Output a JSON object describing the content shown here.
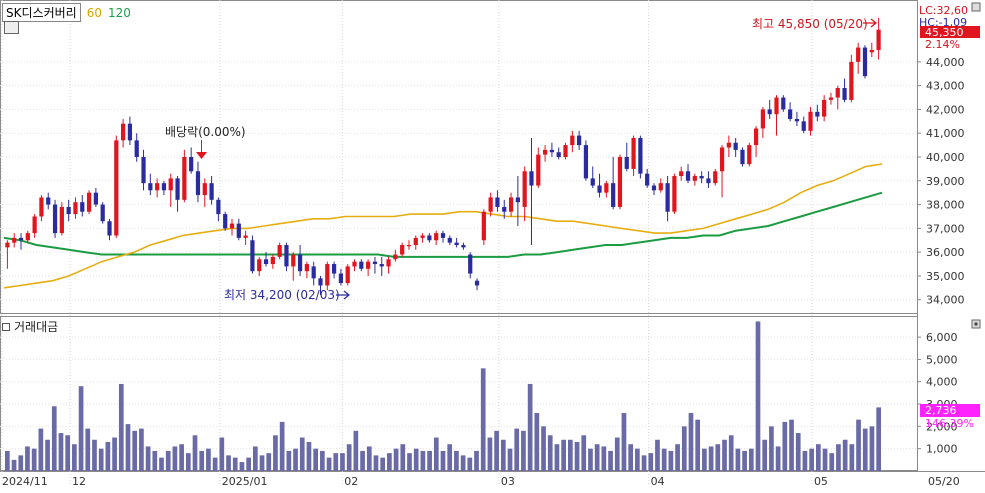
{
  "header": {
    "stock_name": "SK디스커버리",
    "ma60_label": "60",
    "ma120_label": "120"
  },
  "right_labels": {
    "lc": "LC:32,60",
    "hc": "HC:-1,09",
    "current_price": "45,350",
    "change_pct": "2.14%"
  },
  "annotations": {
    "high": "최고 45,850 (05/20)",
    "low": "최저 34,200 (02/03)",
    "dividend": "배당락(0.00%)"
  },
  "volume_panel": {
    "title": "거래대금",
    "current_value": "2,736",
    "pct": "146.39%"
  },
  "colors": {
    "up": "#e0161f",
    "down": "#2b2ba0",
    "ma60": "#e6ad10",
    "ma120": "#1b9c42",
    "vol": "#6a6aa6",
    "badge_red": "#e0161f",
    "badge_magenta": "#ff22ff"
  },
  "chart_data": [
    {
      "type": "candlestick",
      "ylim": [
        33400,
        46600
      ],
      "yticks": [
        "34,000",
        "35,000",
        "36,000",
        "37,000",
        "38,000",
        "39,000",
        "40,000",
        "41,000",
        "42,000",
        "43,000",
        "44,000"
      ],
      "x_labels": [
        "2024/11",
        "12",
        "2025/01",
        "02",
        "03",
        "04",
        "05",
        "05/20"
      ],
      "candles": [
        [
          36200,
          36500,
          35300,
          36400
        ],
        [
          36400,
          36800,
          36200,
          36600
        ],
        [
          36600,
          36800,
          36100,
          36500
        ],
        [
          36500,
          36900,
          36400,
          36800
        ],
        [
          36800,
          37600,
          36600,
          37500
        ],
        [
          37500,
          38400,
          37300,
          38300
        ],
        [
          38300,
          38500,
          37800,
          38000
        ],
        [
          38000,
          38200,
          36600,
          36800
        ],
        [
          36800,
          38100,
          36700,
          37900
        ],
        [
          37900,
          38200,
          37300,
          37600
        ],
        [
          37600,
          38300,
          37400,
          38100
        ],
        [
          38100,
          38400,
          37500,
          37700
        ],
        [
          37700,
          38600,
          37600,
          38500
        ],
        [
          38500,
          38700,
          37900,
          38000
        ],
        [
          38000,
          38100,
          37200,
          37300
        ],
        [
          37300,
          37400,
          36500,
          36700
        ],
        [
          36700,
          40900,
          36600,
          40700
        ],
        [
          40700,
          41600,
          40400,
          41400
        ],
        [
          41400,
          41700,
          40500,
          40700
        ],
        [
          40700,
          41000,
          39800,
          40000
        ],
        [
          40000,
          40300,
          38600,
          38900
        ],
        [
          38900,
          39300,
          38400,
          38600
        ],
        [
          38600,
          39100,
          38300,
          38900
        ],
        [
          38900,
          39000,
          38400,
          38600
        ],
        [
          38600,
          39300,
          37900,
          39100
        ],
        [
          39100,
          39200,
          37700,
          38200
        ],
        [
          38200,
          40300,
          38100,
          40000
        ],
        [
          40000,
          40400,
          39300,
          39400
        ],
        [
          39400,
          39800,
          38100,
          38400
        ],
        [
          38400,
          39100,
          37900,
          38900
        ],
        [
          38900,
          39200,
          38000,
          38200
        ],
        [
          38200,
          38300,
          37300,
          37600
        ],
        [
          37600,
          37700,
          36900,
          37000
        ],
        [
          37000,
          37400,
          36700,
          37200
        ],
        [
          37200,
          37400,
          36500,
          36600
        ],
        [
          36600,
          36900,
          36300,
          36700
        ],
        [
          36500,
          36700,
          35100,
          35200
        ],
        [
          35200,
          35800,
          35000,
          35700
        ],
        [
          35700,
          36000,
          35400,
          35500
        ],
        [
          35500,
          35900,
          35300,
          35800
        ],
        [
          35800,
          36400,
          35700,
          36300
        ],
        [
          36300,
          36400,
          35200,
          35400
        ],
        [
          35400,
          36000,
          34800,
          35900
        ],
        [
          35900,
          36300,
          35000,
          35200
        ],
        [
          35200,
          35600,
          34900,
          35500
        ],
        [
          35400,
          35600,
          34600,
          34900
        ],
        [
          34900,
          35000,
          34200,
          34600
        ],
        [
          34600,
          35600,
          34400,
          35500
        ],
        [
          35500,
          35600,
          34900,
          35100
        ],
        [
          35100,
          35300,
          34600,
          34700
        ],
        [
          34700,
          35500,
          34600,
          35400
        ],
        [
          35400,
          35700,
          35200,
          35600
        ],
        [
          35600,
          35700,
          35200,
          35300
        ],
        [
          35300,
          35700,
          35000,
          35600
        ],
        [
          35600,
          35800,
          35100,
          35500
        ],
        [
          35500,
          35800,
          35000,
          35400
        ],
        [
          35400,
          35800,
          35100,
          35700
        ],
        [
          35700,
          36100,
          35600,
          35900
        ],
        [
          35900,
          36400,
          35800,
          36300
        ],
        [
          36300,
          36500,
          36100,
          36300
        ],
        [
          36300,
          36700,
          36100,
          36600
        ],
        [
          36600,
          36800,
          36400,
          36700
        ],
        [
          36700,
          36800,
          36400,
          36500
        ],
        [
          36500,
          36900,
          36300,
          36800
        ],
        [
          36800,
          36900,
          36400,
          36600
        ],
        [
          36600,
          36700,
          36300,
          36400
        ],
        [
          36400,
          36600,
          36200,
          36300
        ],
        [
          36300,
          36400,
          36100,
          36200
        ],
        [
          35900,
          36000,
          34900,
          35100
        ],
        [
          34800,
          34900,
          34400,
          34600
        ],
        [
          36500,
          37800,
          36300,
          37700
        ],
        [
          37700,
          38500,
          37500,
          38300
        ],
        [
          38300,
          38600,
          37700,
          37900
        ],
        [
          37900,
          38200,
          37400,
          37700
        ],
        [
          37700,
          38500,
          37500,
          38300
        ],
        [
          38300,
          39200,
          37100,
          38100
        ],
        [
          37900,
          39600,
          37300,
          39400
        ],
        [
          39400,
          40800,
          36300,
          38800
        ],
        [
          38800,
          40400,
          38700,
          40100
        ],
        [
          40100,
          40500,
          39800,
          40300
        ],
        [
          40300,
          40600,
          40000,
          40200
        ],
        [
          40200,
          40400,
          39900,
          40000
        ],
        [
          40000,
          40600,
          39900,
          40500
        ],
        [
          40500,
          41100,
          40200,
          40900
        ],
        [
          40900,
          41100,
          40300,
          40500
        ],
        [
          40500,
          40700,
          39000,
          39100
        ],
        [
          39100,
          39600,
          38700,
          38800
        ],
        [
          38800,
          39300,
          38300,
          38500
        ],
        [
          38500,
          39000,
          38300,
          38900
        ],
        [
          38900,
          40000,
          37800,
          37900
        ],
        [
          37900,
          40100,
          37800,
          40000
        ],
        [
          40000,
          40600,
          39400,
          39500
        ],
        [
          39500,
          40900,
          39200,
          40800
        ],
        [
          40800,
          40900,
          39100,
          39300
        ],
        [
          39300,
          39500,
          38700,
          38800
        ],
        [
          38800,
          38900,
          38400,
          38600
        ],
        [
          38600,
          39100,
          38500,
          38900
        ],
        [
          38900,
          39200,
          37300,
          37700
        ],
        [
          37700,
          39300,
          37600,
          39200
        ],
        [
          39200,
          39600,
          39000,
          39400
        ],
        [
          39400,
          39700,
          38900,
          39000
        ],
        [
          39000,
          39300,
          38800,
          39200
        ],
        [
          39200,
          39400,
          38900,
          39100
        ],
        [
          39100,
          39400,
          38700,
          38900
        ],
        [
          38900,
          39500,
          38800,
          39400
        ],
        [
          39400,
          40500,
          38300,
          40400
        ],
        [
          40400,
          40900,
          40000,
          40600
        ],
        [
          40600,
          40800,
          40000,
          40300
        ],
        [
          40300,
          40400,
          39600,
          39700
        ],
        [
          39700,
          40600,
          39600,
          40500
        ],
        [
          40500,
          41300,
          40000,
          41200
        ],
        [
          41200,
          42100,
          40800,
          42000
        ],
        [
          42000,
          42400,
          41600,
          41800
        ],
        [
          41800,
          42600,
          40900,
          42500
        ],
        [
          42500,
          42600,
          41900,
          42000
        ],
        [
          42000,
          42300,
          41500,
          41600
        ],
        [
          41600,
          41900,
          41300,
          41500
        ],
        [
          41500,
          41700,
          41000,
          41100
        ],
        [
          41100,
          42100,
          40900,
          41900
        ],
        [
          41900,
          42200,
          41500,
          41700
        ],
        [
          41700,
          42600,
          41500,
          42400
        ],
        [
          42400,
          42700,
          42200,
          42500
        ],
        [
          42500,
          43000,
          42000,
          42900
        ],
        [
          42900,
          43300,
          42300,
          42400
        ],
        [
          42400,
          44300,
          42300,
          44000
        ],
        [
          44000,
          44800,
          43500,
          44600
        ],
        [
          44600,
          44700,
          43300,
          43400
        ],
        [
          44400,
          44800,
          44200,
          44500
        ],
        [
          44500,
          45850,
          44100,
          45350
        ]
      ],
      "ma60": [
        34.5,
        34.6,
        34.7,
        34.8,
        35.0,
        35.3,
        35.6,
        35.8,
        36.0,
        36.3,
        36.5,
        36.7,
        36.8,
        36.9,
        37.0,
        37.0,
        37.1,
        37.2,
        37.3,
        37.4,
        37.4,
        37.5,
        37.5,
        37.5,
        37.5,
        37.6,
        37.6,
        37.6,
        37.7,
        37.7,
        37.6,
        37.5,
        37.5,
        37.4,
        37.3,
        37.3,
        37.2,
        37.1,
        37.0,
        36.9,
        36.8,
        36.8,
        36.9,
        37.0,
        37.2,
        37.4,
        37.6,
        37.8,
        38.1,
        38.5,
        38.8,
        39.0,
        39.3,
        39.6,
        39.7
      ],
      "ma120": [
        36.6,
        36.5,
        36.3,
        36.2,
        36.1,
        36.0,
        35.9,
        35.9,
        35.9,
        35.9,
        35.9,
        35.9,
        35.9,
        35.9,
        35.9,
        35.9,
        35.9,
        35.9,
        35.9,
        35.9,
        35.9,
        35.9,
        35.9,
        35.9,
        35.8,
        35.8,
        35.8,
        35.8,
        35.8,
        35.8,
        35.8,
        35.8,
        35.9,
        35.9,
        36.0,
        36.1,
        36.2,
        36.3,
        36.3,
        36.4,
        36.5,
        36.6,
        36.6,
        36.7,
        36.7,
        36.9,
        37.0,
        37.1,
        37.3,
        37.5,
        37.7,
        37.9,
        38.1,
        38.3,
        38.5
      ]
    },
    {
      "type": "bar",
      "name": "거래대금",
      "ylim": [
        0,
        6900
      ],
      "yticks": [
        "1,000",
        "2,000",
        "3,000",
        "4,000",
        "5,000",
        "6,000"
      ],
      "values": [
        900,
        500,
        700,
        1100,
        1000,
        1900,
        1400,
        2900,
        1700,
        1600,
        1200,
        3800,
        1900,
        1400,
        1000,
        1300,
        1500,
        3900,
        2100,
        1800,
        1900,
        1100,
        900,
        600,
        900,
        1100,
        1200,
        800,
        1600,
        900,
        1000,
        600,
        1500,
        700,
        600,
        400,
        600,
        1100,
        700,
        800,
        1600,
        2200,
        900,
        1000,
        1500,
        1300,
        1000,
        900,
        600,
        800,
        800,
        1200,
        1800,
        900,
        1100,
        700,
        600,
        800,
        1000,
        1200,
        800,
        1000,
        900,
        900,
        1500,
        900,
        1200,
        900,
        700,
        600,
        900,
        4600,
        1500,
        1800,
        1400,
        1000,
        1900,
        1800,
        3900,
        2600,
        2000,
        1600,
        1200,
        1400,
        1400,
        1300,
        1600,
        1000,
        1200,
        1100,
        900,
        1500,
        2600,
        1200,
        1000,
        700,
        800,
        1400,
        1000,
        900,
        1200,
        2000,
        2600,
        2300,
        1000,
        1100,
        1200,
        1400,
        1600,
        1000,
        900,
        1000,
        6700,
        1400,
        2000,
        1100,
        2200,
        2300,
        1700,
        900,
        1000,
        1200,
        1000,
        800,
        1200,
        1400,
        1200,
        2300,
        1900,
        2000,
        2850
      ]
    }
  ]
}
